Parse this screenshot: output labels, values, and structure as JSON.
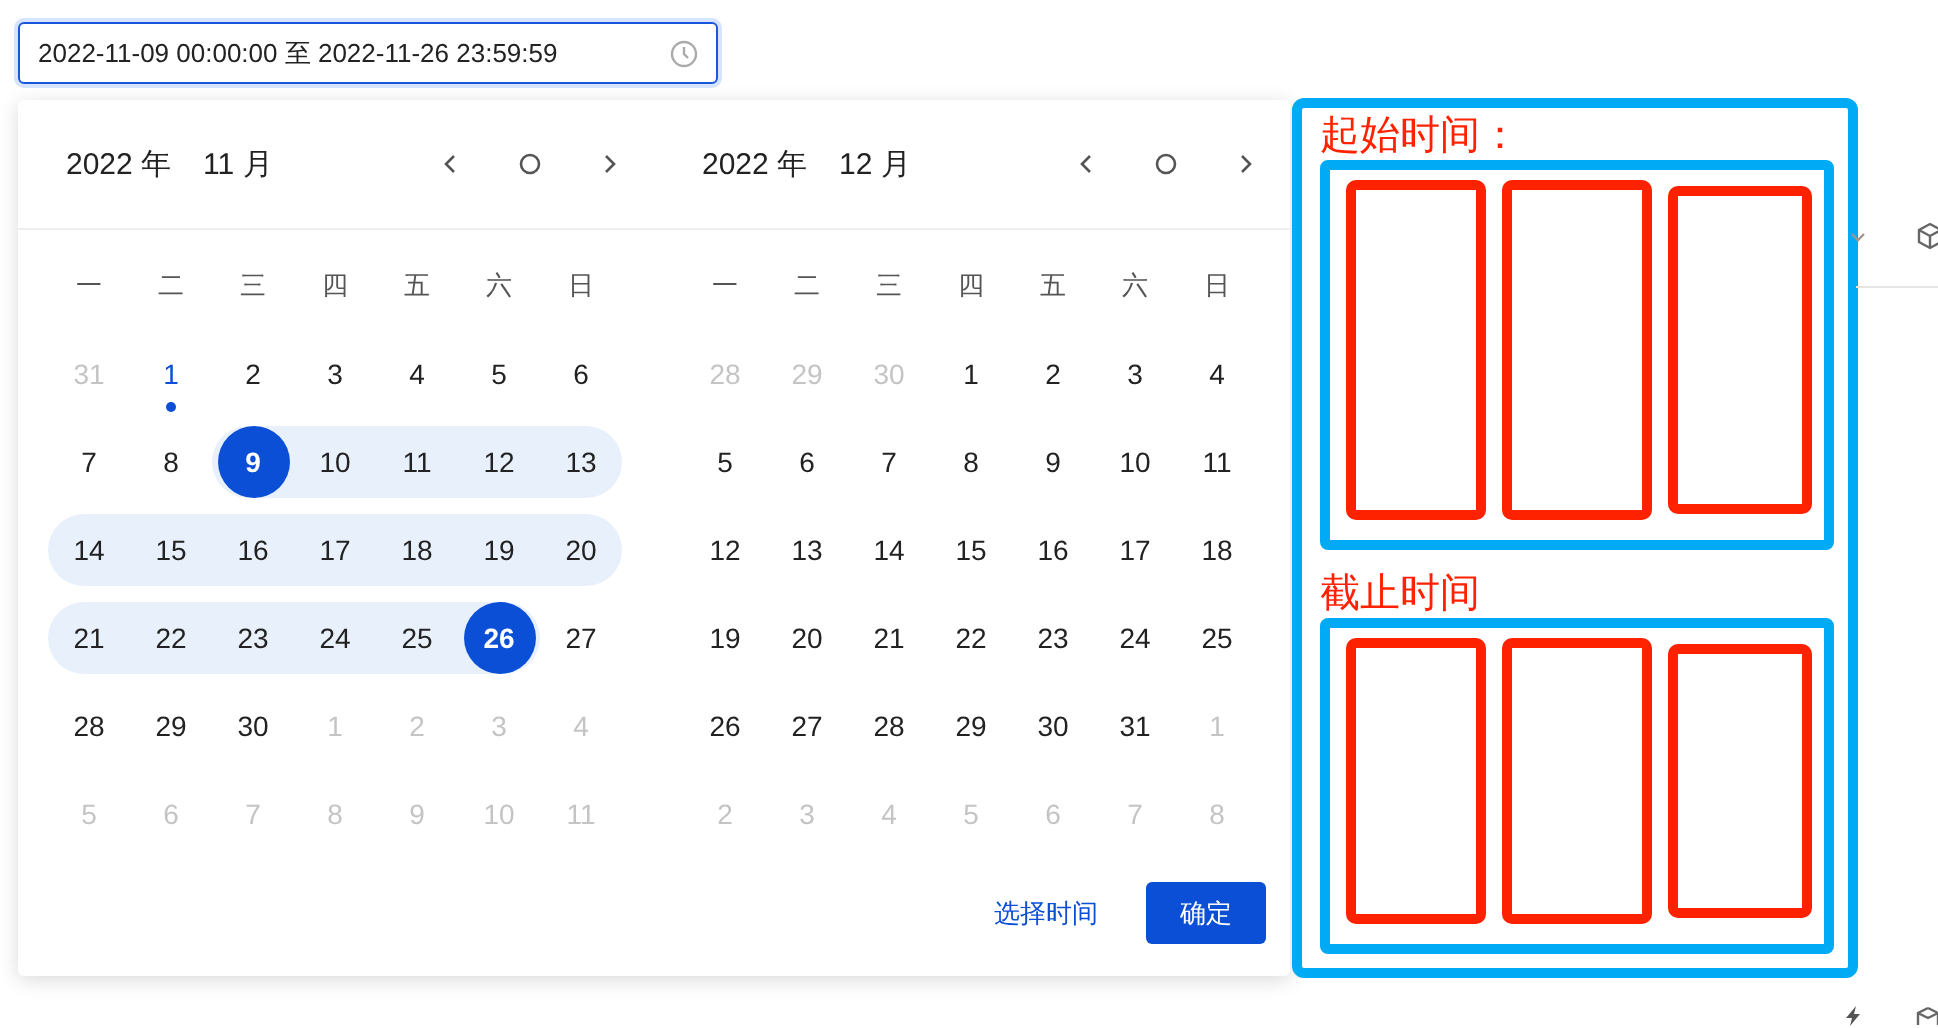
{
  "range_input": {
    "value": "2022-11-09 00:00:00 至 2022-11-26 23:59:59"
  },
  "months": [
    {
      "year": "2022 年",
      "month": "11 月",
      "weekdays": [
        "一",
        "二",
        "三",
        "四",
        "五",
        "六",
        "日"
      ],
      "weeks": [
        [
          {
            "day": "31",
            "muted": true,
            "in_range": false,
            "selected": false,
            "today": false
          },
          {
            "day": "1",
            "muted": false,
            "in_range": false,
            "selected": false,
            "today": true
          },
          {
            "day": "2",
            "muted": false,
            "in_range": false,
            "selected": false,
            "today": false
          },
          {
            "day": "3",
            "muted": false,
            "in_range": false,
            "selected": false,
            "today": false
          },
          {
            "day": "4",
            "muted": false,
            "in_range": false,
            "selected": false,
            "today": false
          },
          {
            "day": "5",
            "muted": false,
            "in_range": false,
            "selected": false,
            "today": false
          },
          {
            "day": "6",
            "muted": false,
            "in_range": false,
            "selected": false,
            "today": false
          }
        ],
        [
          {
            "day": "7",
            "muted": false,
            "in_range": false,
            "selected": false,
            "today": false
          },
          {
            "day": "8",
            "muted": false,
            "in_range": false,
            "selected": false,
            "today": false
          },
          {
            "day": "9",
            "muted": false,
            "in_range": true,
            "selected": true,
            "today": false
          },
          {
            "day": "10",
            "muted": false,
            "in_range": true,
            "selected": false,
            "today": false
          },
          {
            "day": "11",
            "muted": false,
            "in_range": true,
            "selected": false,
            "today": false
          },
          {
            "day": "12",
            "muted": false,
            "in_range": true,
            "selected": false,
            "today": false
          },
          {
            "day": "13",
            "muted": false,
            "in_range": true,
            "selected": false,
            "today": false
          }
        ],
        [
          {
            "day": "14",
            "muted": false,
            "in_range": true,
            "selected": false,
            "today": false
          },
          {
            "day": "15",
            "muted": false,
            "in_range": true,
            "selected": false,
            "today": false
          },
          {
            "day": "16",
            "muted": false,
            "in_range": true,
            "selected": false,
            "today": false
          },
          {
            "day": "17",
            "muted": false,
            "in_range": true,
            "selected": false,
            "today": false
          },
          {
            "day": "18",
            "muted": false,
            "in_range": true,
            "selected": false,
            "today": false
          },
          {
            "day": "19",
            "muted": false,
            "in_range": true,
            "selected": false,
            "today": false
          },
          {
            "day": "20",
            "muted": false,
            "in_range": true,
            "selected": false,
            "today": false
          }
        ],
        [
          {
            "day": "21",
            "muted": false,
            "in_range": true,
            "selected": false,
            "today": false
          },
          {
            "day": "22",
            "muted": false,
            "in_range": true,
            "selected": false,
            "today": false
          },
          {
            "day": "23",
            "muted": false,
            "in_range": true,
            "selected": false,
            "today": false
          },
          {
            "day": "24",
            "muted": false,
            "in_range": true,
            "selected": false,
            "today": false
          },
          {
            "day": "25",
            "muted": false,
            "in_range": true,
            "selected": false,
            "today": false
          },
          {
            "day": "26",
            "muted": false,
            "in_range": true,
            "selected": true,
            "today": false
          },
          {
            "day": "27",
            "muted": false,
            "in_range": false,
            "selected": false,
            "today": false
          }
        ],
        [
          {
            "day": "28",
            "muted": false,
            "in_range": false,
            "selected": false,
            "today": false
          },
          {
            "day": "29",
            "muted": false,
            "in_range": false,
            "selected": false,
            "today": false
          },
          {
            "day": "30",
            "muted": false,
            "in_range": false,
            "selected": false,
            "today": false
          },
          {
            "day": "1",
            "muted": true,
            "in_range": false,
            "selected": false,
            "today": false
          },
          {
            "day": "2",
            "muted": true,
            "in_range": false,
            "selected": false,
            "today": false
          },
          {
            "day": "3",
            "muted": true,
            "in_range": false,
            "selected": false,
            "today": false
          },
          {
            "day": "4",
            "muted": true,
            "in_range": false,
            "selected": false,
            "today": false
          }
        ],
        [
          {
            "day": "5",
            "muted": true,
            "in_range": false,
            "selected": false,
            "today": false
          },
          {
            "day": "6",
            "muted": true,
            "in_range": false,
            "selected": false,
            "today": false
          },
          {
            "day": "7",
            "muted": true,
            "in_range": false,
            "selected": false,
            "today": false
          },
          {
            "day": "8",
            "muted": true,
            "in_range": false,
            "selected": false,
            "today": false
          },
          {
            "day": "9",
            "muted": true,
            "in_range": false,
            "selected": false,
            "today": false
          },
          {
            "day": "10",
            "muted": true,
            "in_range": false,
            "selected": false,
            "today": false
          },
          {
            "day": "11",
            "muted": true,
            "in_range": false,
            "selected": false,
            "today": false
          }
        ]
      ]
    },
    {
      "year": "2022 年",
      "month": "12 月",
      "weekdays": [
        "一",
        "二",
        "三",
        "四",
        "五",
        "六",
        "日"
      ],
      "weeks": [
        [
          {
            "day": "28",
            "muted": true,
            "in_range": false,
            "selected": false,
            "today": false
          },
          {
            "day": "29",
            "muted": true,
            "in_range": false,
            "selected": false,
            "today": false
          },
          {
            "day": "30",
            "muted": true,
            "in_range": false,
            "selected": false,
            "today": false
          },
          {
            "day": "1",
            "muted": false,
            "in_range": false,
            "selected": false,
            "today": false
          },
          {
            "day": "2",
            "muted": false,
            "in_range": false,
            "selected": false,
            "today": false
          },
          {
            "day": "3",
            "muted": false,
            "in_range": false,
            "selected": false,
            "today": false
          },
          {
            "day": "4",
            "muted": false,
            "in_range": false,
            "selected": false,
            "today": false
          }
        ],
        [
          {
            "day": "5",
            "muted": false,
            "in_range": false,
            "selected": false,
            "today": false
          },
          {
            "day": "6",
            "muted": false,
            "in_range": false,
            "selected": false,
            "today": false
          },
          {
            "day": "7",
            "muted": false,
            "in_range": false,
            "selected": false,
            "today": false
          },
          {
            "day": "8",
            "muted": false,
            "in_range": false,
            "selected": false,
            "today": false
          },
          {
            "day": "9",
            "muted": false,
            "in_range": false,
            "selected": false,
            "today": false
          },
          {
            "day": "10",
            "muted": false,
            "in_range": false,
            "selected": false,
            "today": false
          },
          {
            "day": "11",
            "muted": false,
            "in_range": false,
            "selected": false,
            "today": false
          }
        ],
        [
          {
            "day": "12",
            "muted": false,
            "in_range": false,
            "selected": false,
            "today": false
          },
          {
            "day": "13",
            "muted": false,
            "in_range": false,
            "selected": false,
            "today": false
          },
          {
            "day": "14",
            "muted": false,
            "in_range": false,
            "selected": false,
            "today": false
          },
          {
            "day": "15",
            "muted": false,
            "in_range": false,
            "selected": false,
            "today": false
          },
          {
            "day": "16",
            "muted": false,
            "in_range": false,
            "selected": false,
            "today": false
          },
          {
            "day": "17",
            "muted": false,
            "in_range": false,
            "selected": false,
            "today": false
          },
          {
            "day": "18",
            "muted": false,
            "in_range": false,
            "selected": false,
            "today": false
          }
        ],
        [
          {
            "day": "19",
            "muted": false,
            "in_range": false,
            "selected": false,
            "today": false
          },
          {
            "day": "20",
            "muted": false,
            "in_range": false,
            "selected": false,
            "today": false
          },
          {
            "day": "21",
            "muted": false,
            "in_range": false,
            "selected": false,
            "today": false
          },
          {
            "day": "22",
            "muted": false,
            "in_range": false,
            "selected": false,
            "today": false
          },
          {
            "day": "23",
            "muted": false,
            "in_range": false,
            "selected": false,
            "today": false
          },
          {
            "day": "24",
            "muted": false,
            "in_range": false,
            "selected": false,
            "today": false
          },
          {
            "day": "25",
            "muted": false,
            "in_range": false,
            "selected": false,
            "today": false
          }
        ],
        [
          {
            "day": "26",
            "muted": false,
            "in_range": false,
            "selected": false,
            "today": false
          },
          {
            "day": "27",
            "muted": false,
            "in_range": false,
            "selected": false,
            "today": false
          },
          {
            "day": "28",
            "muted": false,
            "in_range": false,
            "selected": false,
            "today": false
          },
          {
            "day": "29",
            "muted": false,
            "in_range": false,
            "selected": false,
            "today": false
          },
          {
            "day": "30",
            "muted": false,
            "in_range": false,
            "selected": false,
            "today": false
          },
          {
            "day": "31",
            "muted": false,
            "in_range": false,
            "selected": false,
            "today": false
          },
          {
            "day": "1",
            "muted": true,
            "in_range": false,
            "selected": false,
            "today": false
          }
        ],
        [
          {
            "day": "2",
            "muted": true,
            "in_range": false,
            "selected": false,
            "today": false
          },
          {
            "day": "3",
            "muted": true,
            "in_range": false,
            "selected": false,
            "today": false
          },
          {
            "day": "4",
            "muted": true,
            "in_range": false,
            "selected": false,
            "today": false
          },
          {
            "day": "5",
            "muted": true,
            "in_range": false,
            "selected": false,
            "today": false
          },
          {
            "day": "6",
            "muted": true,
            "in_range": false,
            "selected": false,
            "today": false
          },
          {
            "day": "7",
            "muted": true,
            "in_range": false,
            "selected": false,
            "today": false
          },
          {
            "day": "8",
            "muted": true,
            "in_range": false,
            "selected": false,
            "today": false
          }
        ]
      ]
    }
  ],
  "footer": {
    "time_link": "选择时间",
    "confirm_button": "确定"
  },
  "annotations": [
    {
      "label": "起始时间："
    },
    {
      "label": "截止时间"
    }
  ]
}
